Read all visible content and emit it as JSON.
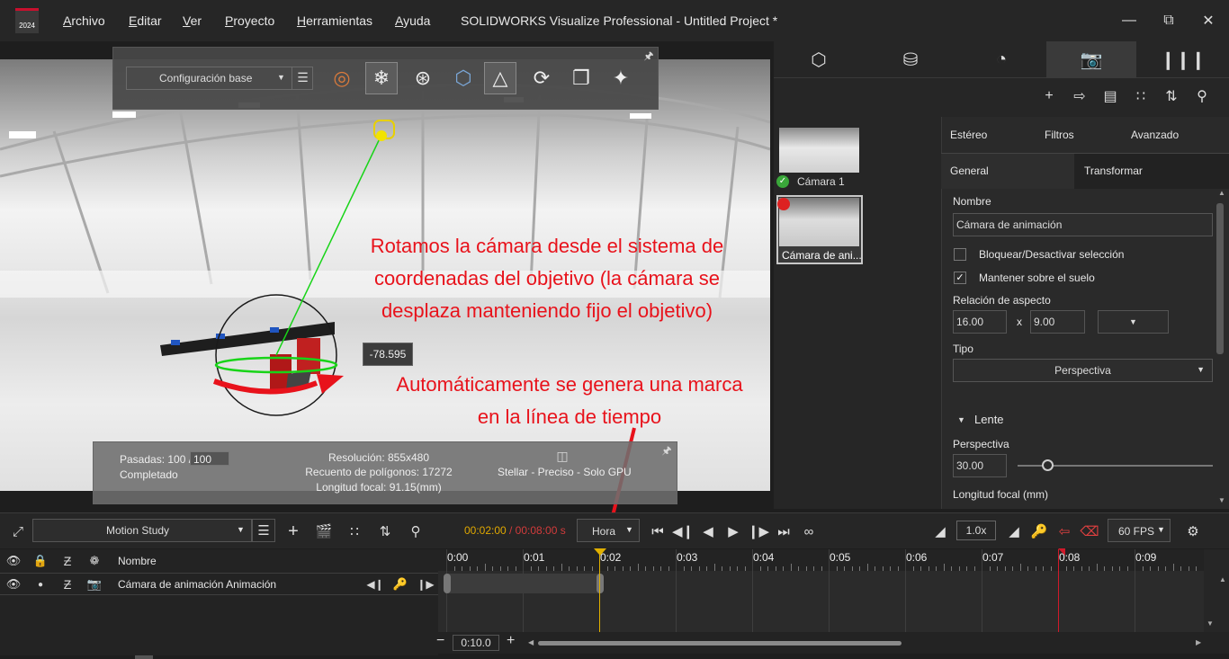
{
  "app": {
    "logo_text": "2024",
    "title": "SOLIDWORKS Visualize Professional - Untitled Project *",
    "menu": [
      "Archivo",
      "Editar",
      "Ver",
      "Proyecto",
      "Herramientas",
      "Ayuda"
    ]
  },
  "viewport": {
    "config_select": "Configuración base",
    "angle_readout": "-78.595",
    "annotation_1": "Rotamos la cámara desde el sistema de coordenadas del objetivo (la cámara se desplaza manteniendo fijo el objetivo)",
    "annotation_2": "Automáticamente se genera una marca en la línea de tiempo",
    "status": {
      "passes_label": "Pasadas: 100 /",
      "passes_value": "100",
      "completed": "Completado",
      "resolution": "Resolución: 855x480",
      "polygons": "Recuento de polígonos: 17272",
      "focal_length": "Longitud focal: 91.15(mm)",
      "render_mode": "Stellar - Preciso - Solo GPU"
    }
  },
  "cameras": [
    {
      "label": "Cámara 1"
    },
    {
      "label": "Cámara de ani..."
    }
  ],
  "properties": {
    "tabs_top": [
      "Estéreo",
      "Filtros",
      "Avanzado"
    ],
    "tabs_sub": [
      "General",
      "Transformar"
    ],
    "name_label": "Nombre",
    "name_value": "Cámara de animación",
    "lock_label": "Bloquear/Desactivar selección",
    "ground_label": "Mantener sobre el suelo",
    "aspect_label": "Relación de aspecto",
    "aspect_w": "16.00",
    "aspect_x": "x",
    "aspect_h": "9.00",
    "type_label": "Tipo",
    "type_value": "Perspectiva",
    "lens_section": "Lente",
    "perspective_label": "Perspectiva",
    "perspective_value": "30.00",
    "perspective_slider_fraction": 0.15,
    "focal_label": "Longitud focal (mm)"
  },
  "timeline": {
    "study_select": "Motion Study",
    "current_time": "00:02:00",
    "total_time": "/ 00:08:00 s",
    "unit_select": "Hora",
    "speed": "1.0x",
    "fps": "60 FPS",
    "header_name": "Nombre",
    "track_name": "Cámara de animación Animación",
    "ticks": [
      "0:00",
      "0:01",
      "0:02",
      "0:03",
      "0:04",
      "0:05",
      "0:06",
      "0:07",
      "0:08",
      "0:09"
    ],
    "zoom_value": "0:10.0",
    "minus": "−",
    "plus": "+"
  },
  "colors": {
    "accent_red": "#e8121b",
    "time_current": "#e0a800",
    "time_total": "#d23b3b",
    "playhead": "#e0b000",
    "end_marker": "#d0192a",
    "gizmo_green": "#18d418"
  }
}
